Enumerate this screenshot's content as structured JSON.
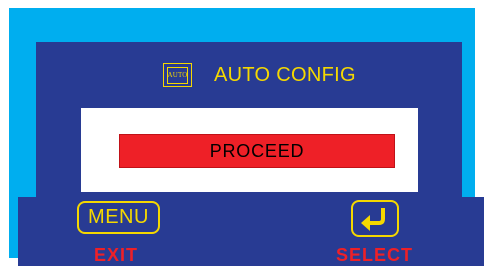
{
  "header": {
    "icon_name": "auto-config-icon",
    "icon_text": "AUTO",
    "title": "AUTO CONFIG"
  },
  "dialog": {
    "proceed_label": "PROCEED"
  },
  "controls": {
    "menu_label": "MENU",
    "menu_action": "EXIT",
    "select_icon": "enter-return-icon",
    "select_action": "SELECT"
  },
  "colors": {
    "frame": "#00aeef",
    "panel_bg": "#283b93",
    "accent_yellow": "#f5d800",
    "highlight_red": "#ee2027"
  }
}
